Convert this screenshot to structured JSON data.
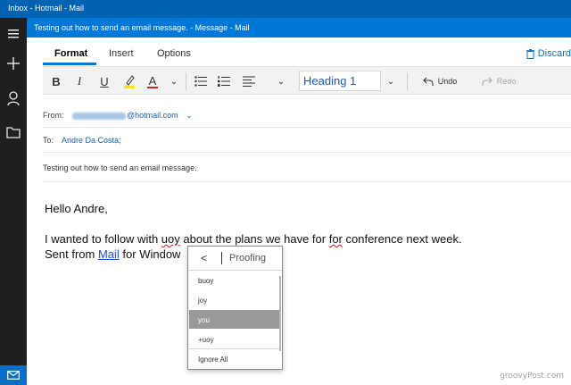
{
  "window": {
    "inbox_title": "Inbox - Hotmail - Mail"
  },
  "compose": {
    "title": "Testing out how to send an email message. - Message - Mail",
    "tabs": [
      {
        "label": "Format",
        "active": true
      },
      {
        "label": "Insert",
        "active": false
      },
      {
        "label": "Options",
        "active": false
      }
    ],
    "discard_label": "Discard"
  },
  "toolbar": {
    "bold": "B",
    "italic": "I",
    "underline": "U",
    "font_color": "A",
    "style_value": "Heading 1",
    "undo_label": "Undo",
    "redo_label": "Redo"
  },
  "fields": {
    "from_label": "From:",
    "from_value": "@hotmail.com",
    "to_label": "To:",
    "to_value": "Andre Da Costa;",
    "subject": "Testing out how to send an email message."
  },
  "body": {
    "greeting": "Hello Andre,",
    "line1_before": "I wanted to follow with ",
    "line1_misspelled": "uoy",
    "line1_mid": " about the plans we have for ",
    "line1_duplicate": "for",
    "line1_after": " conference  next week.",
    "line2_before": "Sent from ",
    "line2_link": "Mail",
    "line2_after": " for Window"
  },
  "proofing": {
    "back": "<",
    "title": "Proofing",
    "items": [
      {
        "label": "buoy",
        "selected": false
      },
      {
        "label": "joy",
        "selected": false
      },
      {
        "label": "you",
        "selected": true
      },
      {
        "label": "+uoy",
        "selected": false
      },
      {
        "label": "Ignore All",
        "selected": false
      }
    ]
  },
  "watermark": "groovyPost.com",
  "colors": {
    "accent": "#0078d7",
    "rail": "#1f1f1f",
    "link": "#1a5fa8",
    "selection": "#999999"
  }
}
